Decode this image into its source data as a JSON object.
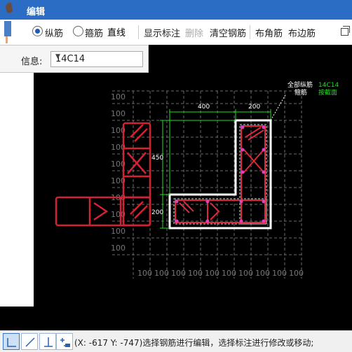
{
  "window": {
    "title": "编辑"
  },
  "toolbar": {
    "radio_longitudinal": "纵筋",
    "radio_stirrup": "箍筋",
    "line_mode": "直线",
    "show_annotation": "显示标注",
    "delete": "删除",
    "clear_rebar": "清空钢筋",
    "corner_rebar": "布角筋",
    "edge_rebar": "布边筋"
  },
  "info": {
    "label": "信息:",
    "value": "14C14"
  },
  "drawing": {
    "legend_all_longitudinal": "全部纵筋",
    "legend_stirrup": "箍筋",
    "legend_value": "14C14",
    "legend_value2": "按截面",
    "dim_400": "400",
    "dim_200_top": "200",
    "dim_450": "450",
    "dim_200_side": "200",
    "grid_label": "100",
    "colors": {
      "section": "#ffffff",
      "rebar": "#e0283a",
      "dim": "#22dd22",
      "grid": "#777777",
      "stirrup_dash": "#dddddd"
    }
  },
  "statusbar": {
    "text": "(X: -617 Y: -747)选择钢筋进行编辑，选择标注进行修改或移动;",
    "icons": [
      "ortho-mode-icon",
      "polar-mode-icon",
      "snap-mode-icon",
      "dynamic-input-icon"
    ]
  }
}
